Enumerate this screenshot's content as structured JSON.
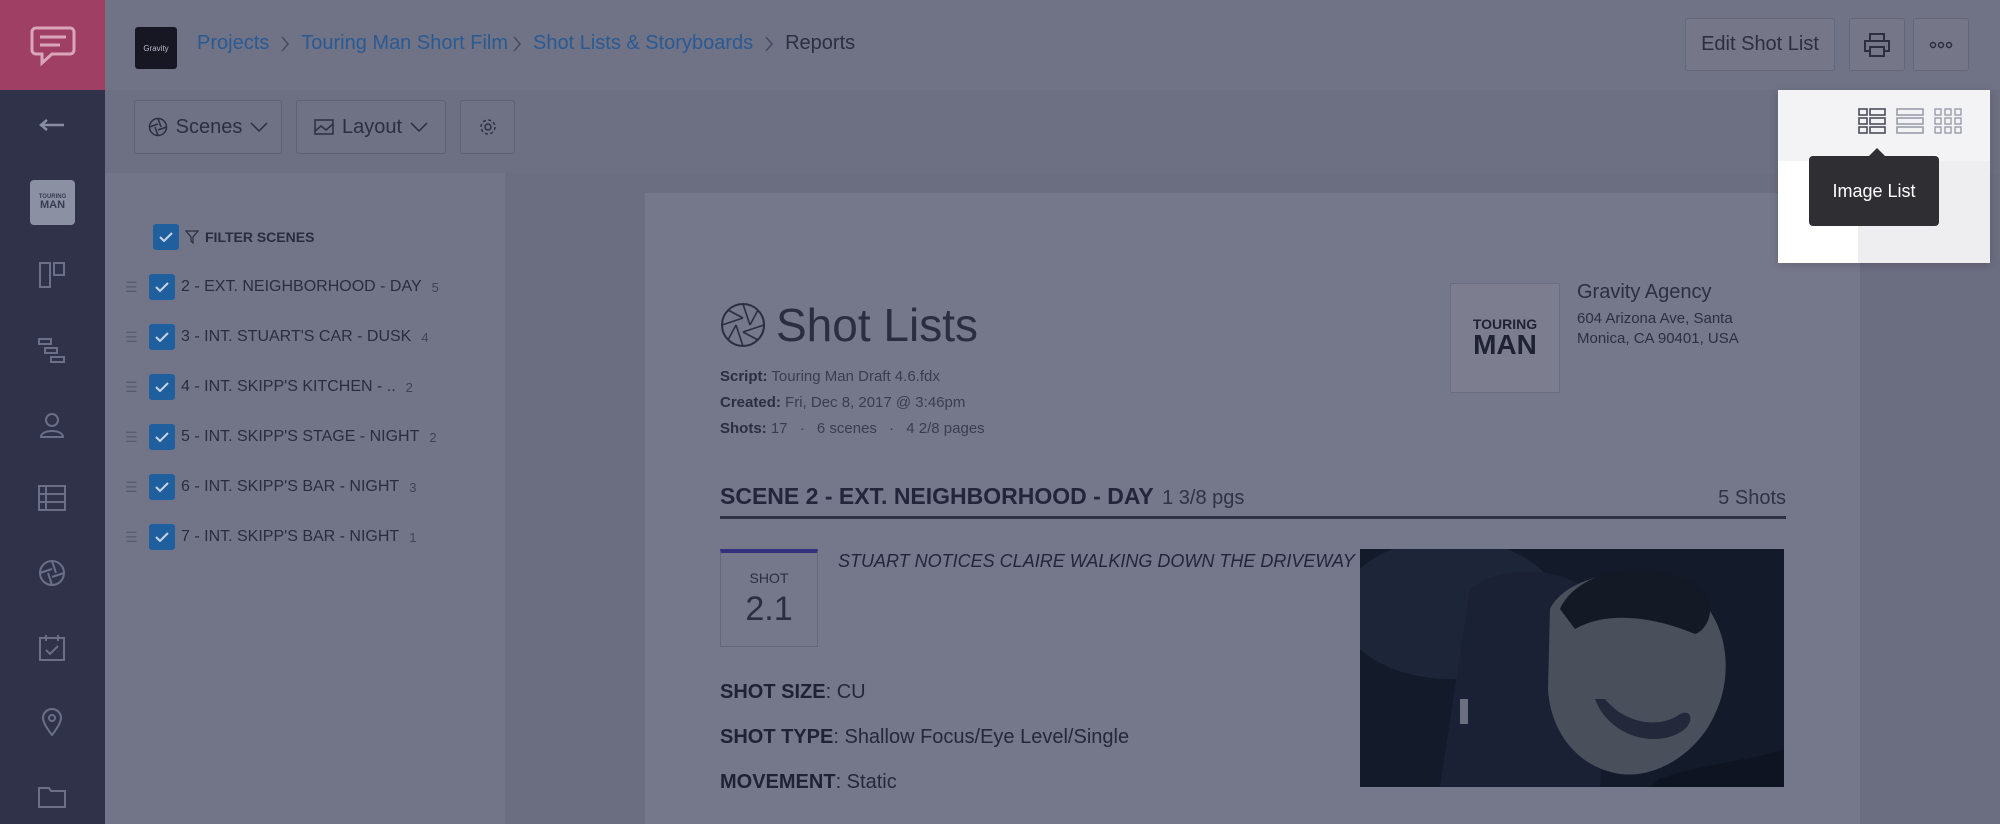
{
  "header": {
    "project_logo_text": "Gravity",
    "breadcrumbs": [
      "Projects",
      "Touring Man Short Film",
      "Shot Lists & Storyboards"
    ],
    "current_page": "Reports",
    "edit_button": "Edit Shot List"
  },
  "rail": {
    "project_thumb_line1": "TOURING",
    "project_thumb_line2": "MAN"
  },
  "toolbar": {
    "scenes_label": "Scenes",
    "layout_label": "Layout"
  },
  "view_switcher": {
    "tooltip": "Image List"
  },
  "scene_filter": {
    "header": "FILTER SCENES",
    "scenes": [
      {
        "label": "2 - EXT. NEIGHBORHOOD - DAY",
        "count": "5"
      },
      {
        "label": "3 - INT. STUART'S CAR - DUSK",
        "count": "4"
      },
      {
        "label": "4 - INT. SKIPP'S KITCHEN - ..",
        "count": "2"
      },
      {
        "label": "5 - INT. SKIPP'S STAGE - NIGHT",
        "count": "2"
      },
      {
        "label": "6 - INT. SKIPP'S BAR - NIGHT",
        "count": "3"
      },
      {
        "label": "7 - INT. SKIPP'S BAR - NIGHT",
        "count": "1"
      }
    ]
  },
  "document": {
    "title": "Shot Lists",
    "script_label": "Script:",
    "script_value": "Touring Man Draft 4.6.fdx",
    "created_label": "Created:",
    "created_value": "Fri, Dec 8, 2017 @ 3:46pm",
    "shots_label": "Shots:",
    "shots_value": "17",
    "scenes_count": "6 scenes",
    "pages_count": "4 2/8 pages",
    "logo_line1": "TOURING",
    "logo_line2": "MAN",
    "agency_name": "Gravity Agency",
    "agency_address_1": "604 Arizona Ave, Santa",
    "agency_address_2": "Monica, CA 90401, USA",
    "scene_heading": "SCENE 2 - EXT. NEIGHBORHOOD - DAY",
    "scene_pages": "1 3/8 pgs",
    "scene_shots": "5 Shots",
    "shot_label": "SHOT",
    "shot_number": "2.1",
    "shot_description": "STUART NOTICES CLAIRE WALKING DOWN THE DRIVEWAY",
    "shot_size_label": "SHOT SIZE",
    "shot_size_value": ": CU",
    "shot_type_label": "SHOT TYPE",
    "shot_type_value": ": Shallow Focus/Eye Level/Single",
    "movement_label": "MOVEMENT",
    "movement_value": ": Static"
  }
}
